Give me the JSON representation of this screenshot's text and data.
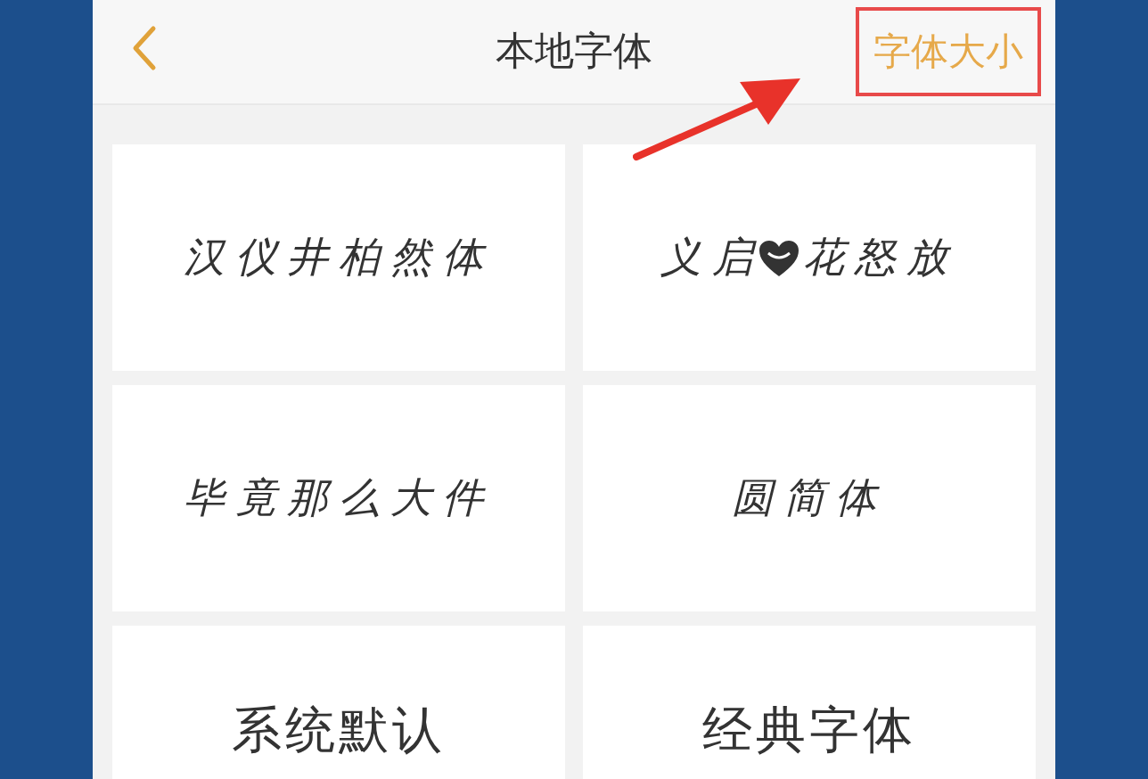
{
  "header": {
    "title": "本地字体",
    "action": "字体大小",
    "action_highlighted": true
  },
  "fonts": [
    {
      "kind": "handwriting",
      "label": "汉仪井柏然体"
    },
    {
      "kind": "handwriting",
      "label": "义启",
      "label_after_icon": "花怒放"
    },
    {
      "kind": "handwriting",
      "label": "毕竟那么大件"
    },
    {
      "kind": "handwriting",
      "label": "圆简体"
    },
    {
      "kind": "regular",
      "label": "系统默认"
    },
    {
      "kind": "regular",
      "label": "经典字体"
    }
  ]
}
